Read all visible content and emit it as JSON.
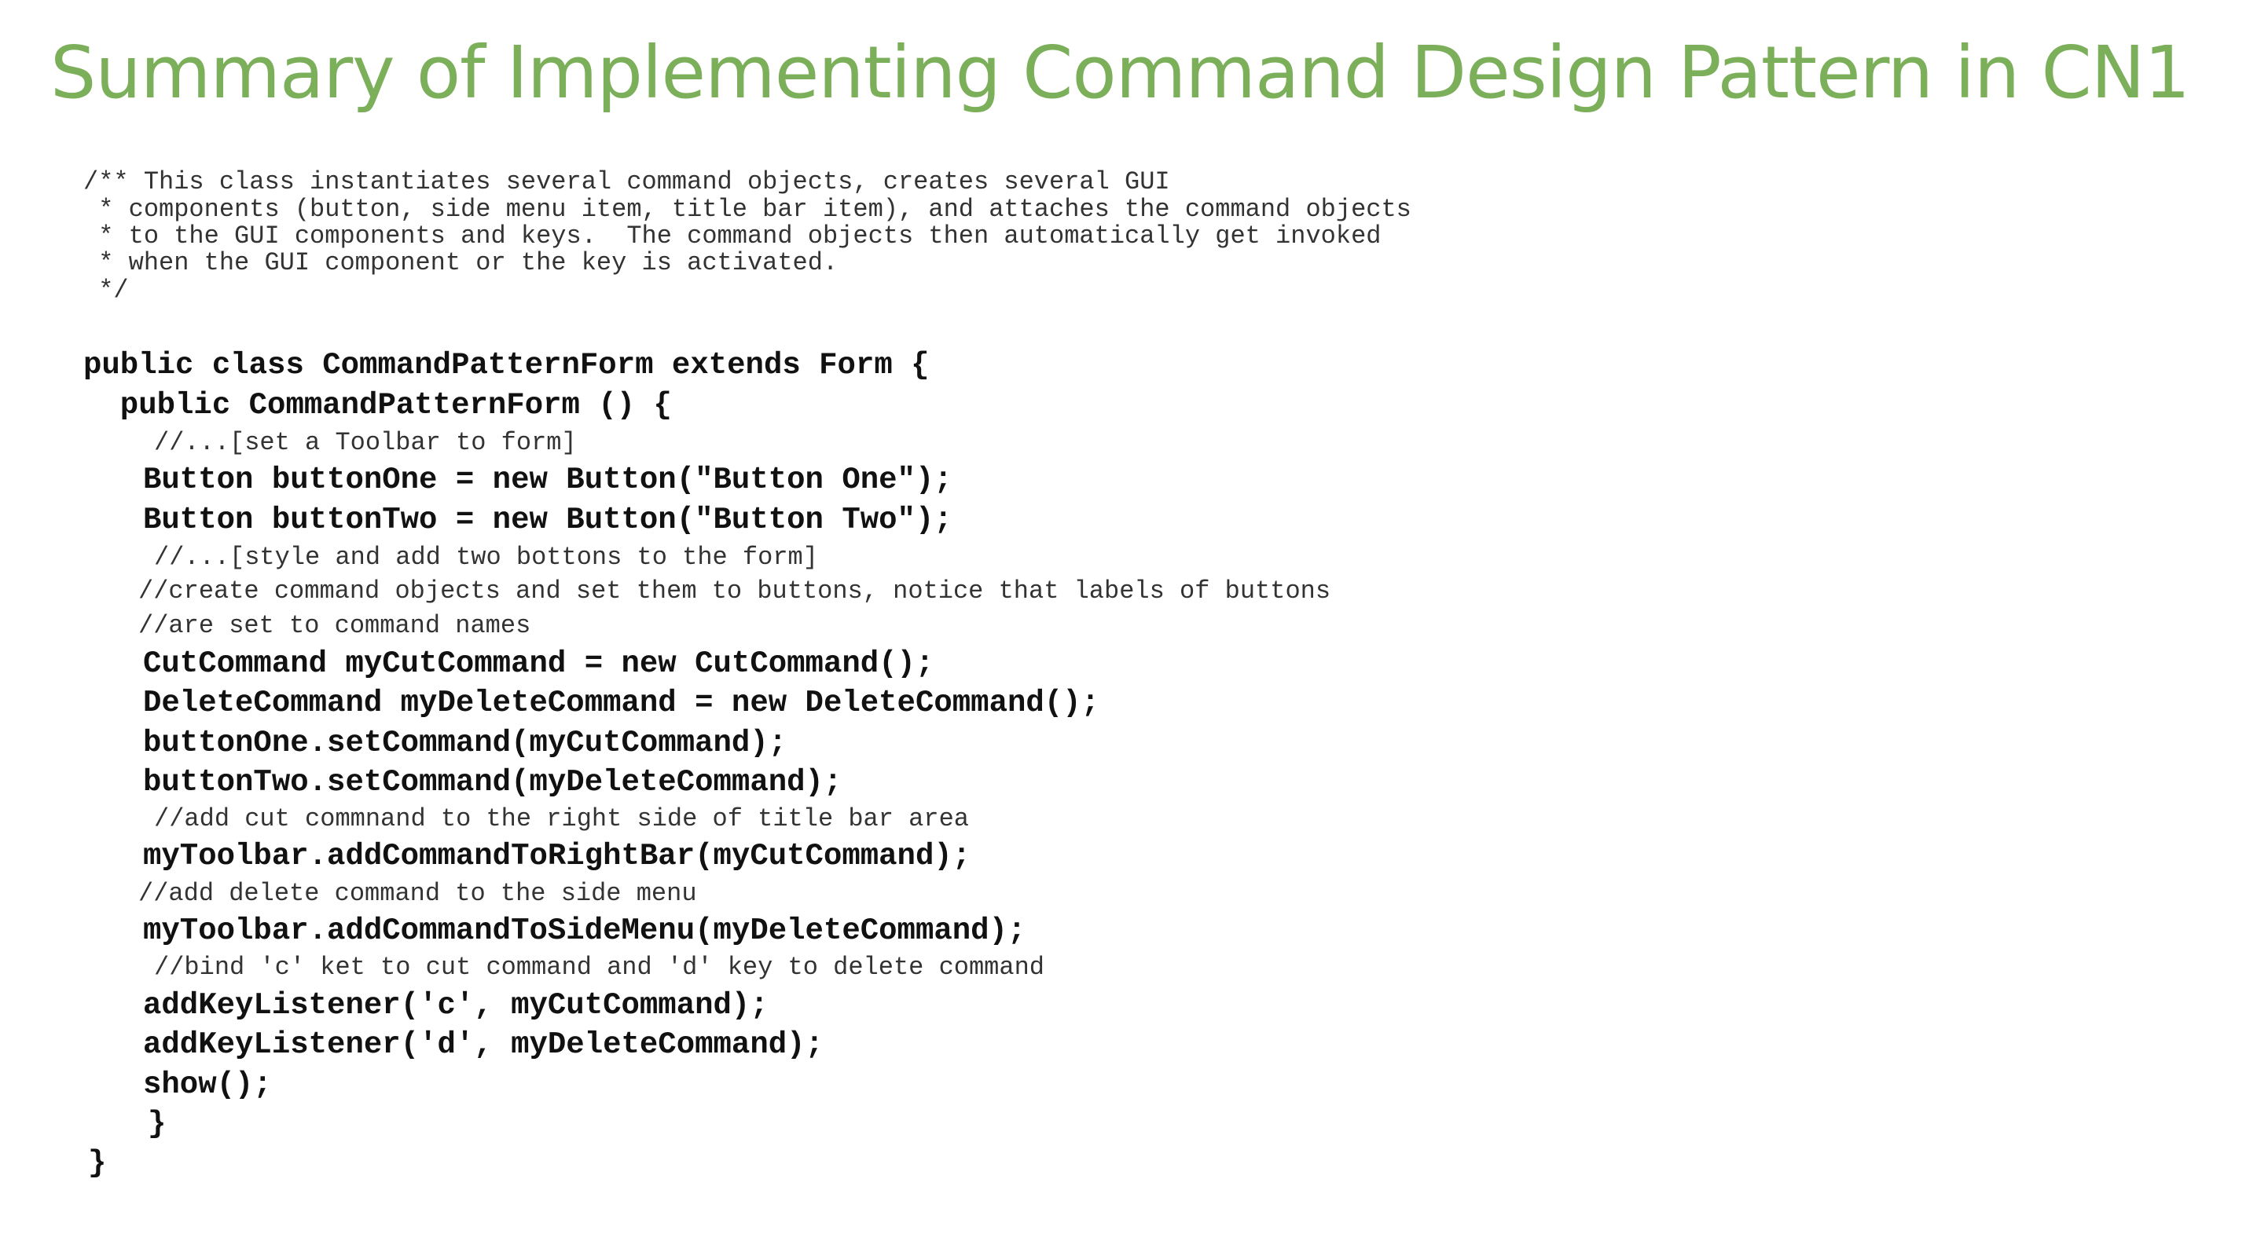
{
  "title": "Summary of Implementing Command Design Pattern in CN1",
  "code_lines": [
    "/** This class instantiates several command objects, creates several GUI",
    " * components (button, side menu item, title bar item), and attaches the command objects",
    " * to the GUI components and keys.  The command objects then automatically get invoked",
    " * when the GUI component or the key is activated.",
    " */",
    "public class CommandPatternForm extends Form {",
    "  public CommandPatternForm () {",
    "//...[set a Toolbar to form]",
    "Button buttonOne = new Button(\"Button One\");",
    "Button buttonTwo = new Button(\"Button Two\");",
    "//...[style and add two bottons to the form]",
    "//create command objects and set them to buttons, notice that labels of buttons",
    "//are set to command names",
    "CutCommand myCutCommand = new CutCommand();",
    "DeleteCommand myDeleteCommand = new DeleteCommand();",
    "buttonOne.setCommand(myCutCommand);",
    "buttonTwo.setCommand(myDeleteCommand);",
    "//add cut commnand to the right side of title bar area",
    "myToolbar.addCommandToRightBar(myCutCommand);",
    "//add delete command to the side menu",
    "myToolbar.addCommandToSideMenu(myDeleteCommand);",
    "//bind 'c' ket to cut command and 'd' key to delete command",
    "addKeyListener('c', myCutCommand);",
    "addKeyListener('d', myDeleteCommand);",
    "show();",
    "}",
    "}"
  ]
}
